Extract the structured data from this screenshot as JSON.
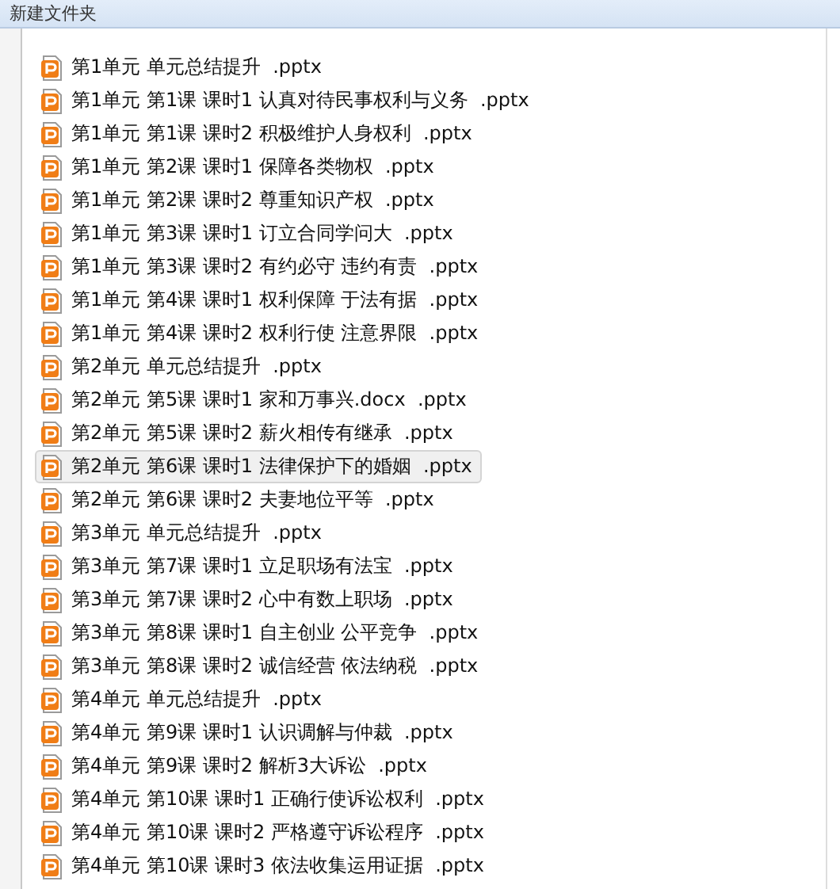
{
  "window": {
    "title": "新建文件夹"
  },
  "files": [
    {
      "name": "第1单元 单元总结提升  .pptx",
      "selected": false
    },
    {
      "name": "第1单元 第1课 课时1 认真对待民事权利与义务  .pptx",
      "selected": false
    },
    {
      "name": "第1单元 第1课 课时2 积极维护人身权利  .pptx",
      "selected": false
    },
    {
      "name": "第1单元 第2课 课时1 保障各类物权  .pptx",
      "selected": false
    },
    {
      "name": "第1单元 第2课 课时2 尊重知识产权  .pptx",
      "selected": false
    },
    {
      "name": "第1单元 第3课 课时1 订立合同学问大  .pptx",
      "selected": false
    },
    {
      "name": "第1单元 第3课 课时2 有约必守 违约有责  .pptx",
      "selected": false
    },
    {
      "name": "第1单元 第4课 课时1 权利保障 于法有据  .pptx",
      "selected": false
    },
    {
      "name": "第1单元 第4课 课时2 权利行使 注意界限  .pptx",
      "selected": false
    },
    {
      "name": "第2单元 单元总结提升  .pptx",
      "selected": false
    },
    {
      "name": "第2单元 第5课 课时1 家和万事兴.docx  .pptx",
      "selected": false
    },
    {
      "name": "第2单元 第5课 课时2 薪火相传有继承  .pptx",
      "selected": false
    },
    {
      "name": "第2单元 第6课 课时1 法律保护下的婚姻  .pptx",
      "selected": true
    },
    {
      "name": "第2单元 第6课 课时2 夫妻地位平等  .pptx",
      "selected": false
    },
    {
      "name": "第3单元 单元总结提升  .pptx",
      "selected": false
    },
    {
      "name": "第3单元 第7课 课时1 立足职场有法宝  .pptx",
      "selected": false
    },
    {
      "name": "第3单元 第7课 课时2 心中有数上职场  .pptx",
      "selected": false
    },
    {
      "name": "第3单元 第8课 课时1 自主创业 公平竞争  .pptx",
      "selected": false
    },
    {
      "name": "第3单元 第8课 课时2 诚信经营 依法纳税  .pptx",
      "selected": false
    },
    {
      "name": "第4单元 单元总结提升  .pptx",
      "selected": false
    },
    {
      "name": "第4单元 第9课 课时1 认识调解与仲裁  .pptx",
      "selected": false
    },
    {
      "name": "第4单元 第9课 课时2 解析3大诉讼  .pptx",
      "selected": false
    },
    {
      "name": "第4单元 第10课 课时1 正确行使诉讼权利  .pptx",
      "selected": false
    },
    {
      "name": "第4单元 第10课 课时2 严格遵守诉讼程序  .pptx",
      "selected": false
    },
    {
      "name": "第4单元 第10课 课时3 依法收集运用证据  .pptx",
      "selected": false
    }
  ]
}
